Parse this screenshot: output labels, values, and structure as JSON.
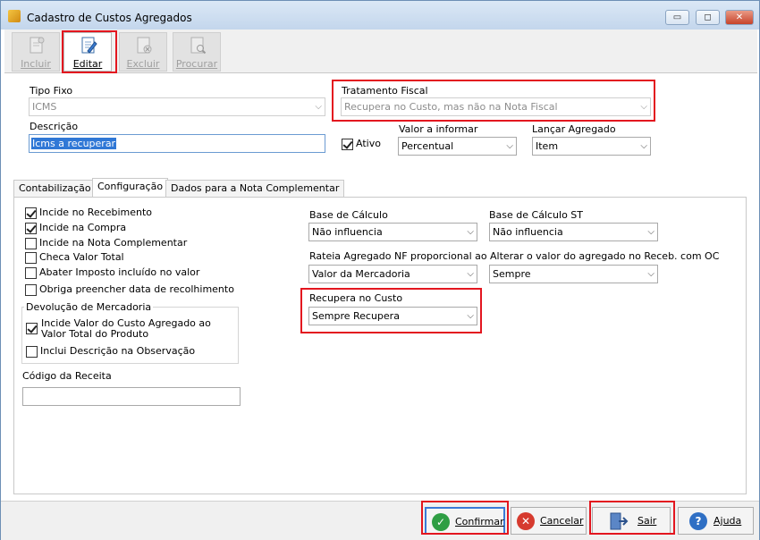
{
  "window": {
    "title": "Cadastro de Custos Agregados",
    "minimize_label": "▭",
    "restore_label": "◻",
    "close_label": "✕"
  },
  "toolbar": {
    "incluir": "Incluir",
    "editar": "Editar",
    "excluir": "Excluir",
    "procurar": "Procurar"
  },
  "form": {
    "tipo_fixo_label": "Tipo Fixo",
    "tipo_fixo_value": "ICMS",
    "tratamento_fiscal_label": "Tratamento Fiscal",
    "tratamento_fiscal_value": "Recupera no Custo, mas não na Nota Fiscal",
    "descricao_label": "Descrição",
    "descricao_value": "Icms a recuperar",
    "ativo_label": "Ativo",
    "valor_informar_label": "Valor a informar",
    "valor_informar_value": "Percentual",
    "lancar_agregado_label": "Lançar Agregado",
    "lancar_agregado_value": "Item"
  },
  "tabs": [
    "Contabilização",
    "Configuração",
    "Dados para a Nota Complementar"
  ],
  "config": {
    "checks": [
      {
        "label": "Incide no Recebimento",
        "checked": true
      },
      {
        "label": "Incide na Compra",
        "checked": true
      },
      {
        "label": "Incide na Nota Complementar",
        "checked": false
      },
      {
        "label": "Checa Valor Total",
        "checked": false
      },
      {
        "label": "Abater Imposto incluído no valor",
        "checked": false
      },
      {
        "label": "Obriga preencher data de recolhimento",
        "checked": false
      }
    ],
    "devolucao_title": "Devolução de Mercadoria",
    "devolucao_check1": "Incide Valor do Custo Agregado ao Valor Total do Produto",
    "devolucao_check2": "Inclui Descrição na Observação",
    "codigo_receita_label": "Código da Receita",
    "codigo_receita_value": "",
    "base_calculo_label": "Base de Cálculo",
    "base_calculo_value": "Não influencia",
    "base_calculo_st_label": "Base de Cálculo ST",
    "base_calculo_st_value": "Não influencia",
    "rateia_label": "Rateia Agregado NF proporcional ao",
    "rateia_value": "Valor da Mercadoria",
    "alterar_label": "Alterar o valor do agregado no Receb. com OC",
    "alterar_value": "Sempre",
    "recupera_label": "Recupera no Custo",
    "recupera_value": "Sempre Recupera"
  },
  "footer": {
    "confirmar": "Confirmar",
    "cancelar": "Cancelar",
    "sair": "Sair",
    "ajuda": "Ajuda"
  },
  "colors": {
    "highlight": "#e3161f",
    "confirm_icon": "#2f9e44",
    "cancel_icon": "#d63b2f",
    "help_icon": "#2f6fc4",
    "selection": "#3078d6"
  }
}
